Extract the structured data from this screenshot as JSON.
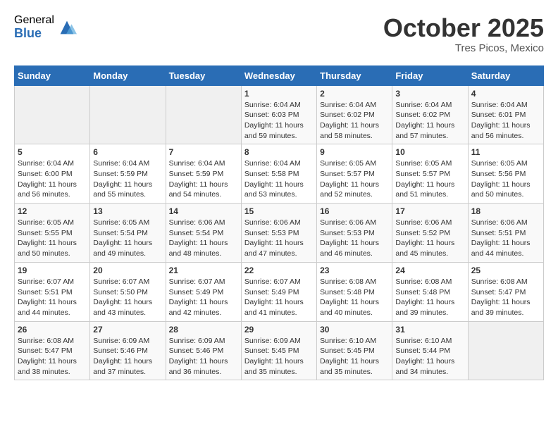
{
  "header": {
    "logo_general": "General",
    "logo_blue": "Blue",
    "month": "October 2025",
    "location": "Tres Picos, Mexico"
  },
  "days_of_week": [
    "Sunday",
    "Monday",
    "Tuesday",
    "Wednesday",
    "Thursday",
    "Friday",
    "Saturday"
  ],
  "weeks": [
    [
      {
        "day": "",
        "empty": true
      },
      {
        "day": "",
        "empty": true
      },
      {
        "day": "",
        "empty": true
      },
      {
        "day": "1",
        "sunrise": "6:04 AM",
        "sunset": "6:03 PM",
        "daylight": "11 hours and 59 minutes."
      },
      {
        "day": "2",
        "sunrise": "6:04 AM",
        "sunset": "6:02 PM",
        "daylight": "11 hours and 58 minutes."
      },
      {
        "day": "3",
        "sunrise": "6:04 AM",
        "sunset": "6:02 PM",
        "daylight": "11 hours and 57 minutes."
      },
      {
        "day": "4",
        "sunrise": "6:04 AM",
        "sunset": "6:01 PM",
        "daylight": "11 hours and 56 minutes."
      }
    ],
    [
      {
        "day": "5",
        "sunrise": "6:04 AM",
        "sunset": "6:00 PM",
        "daylight": "11 hours and 56 minutes."
      },
      {
        "day": "6",
        "sunrise": "6:04 AM",
        "sunset": "5:59 PM",
        "daylight": "11 hours and 55 minutes."
      },
      {
        "day": "7",
        "sunrise": "6:04 AM",
        "sunset": "5:59 PM",
        "daylight": "11 hours and 54 minutes."
      },
      {
        "day": "8",
        "sunrise": "6:04 AM",
        "sunset": "5:58 PM",
        "daylight": "11 hours and 53 minutes."
      },
      {
        "day": "9",
        "sunrise": "6:05 AM",
        "sunset": "5:57 PM",
        "daylight": "11 hours and 52 minutes."
      },
      {
        "day": "10",
        "sunrise": "6:05 AM",
        "sunset": "5:57 PM",
        "daylight": "11 hours and 51 minutes."
      },
      {
        "day": "11",
        "sunrise": "6:05 AM",
        "sunset": "5:56 PM",
        "daylight": "11 hours and 50 minutes."
      }
    ],
    [
      {
        "day": "12",
        "sunrise": "6:05 AM",
        "sunset": "5:55 PM",
        "daylight": "11 hours and 50 minutes."
      },
      {
        "day": "13",
        "sunrise": "6:05 AM",
        "sunset": "5:54 PM",
        "daylight": "11 hours and 49 minutes."
      },
      {
        "day": "14",
        "sunrise": "6:06 AM",
        "sunset": "5:54 PM",
        "daylight": "11 hours and 48 minutes."
      },
      {
        "day": "15",
        "sunrise": "6:06 AM",
        "sunset": "5:53 PM",
        "daylight": "11 hours and 47 minutes."
      },
      {
        "day": "16",
        "sunrise": "6:06 AM",
        "sunset": "5:53 PM",
        "daylight": "11 hours and 46 minutes."
      },
      {
        "day": "17",
        "sunrise": "6:06 AM",
        "sunset": "5:52 PM",
        "daylight": "11 hours and 45 minutes."
      },
      {
        "day": "18",
        "sunrise": "6:06 AM",
        "sunset": "5:51 PM",
        "daylight": "11 hours and 44 minutes."
      }
    ],
    [
      {
        "day": "19",
        "sunrise": "6:07 AM",
        "sunset": "5:51 PM",
        "daylight": "11 hours and 44 minutes."
      },
      {
        "day": "20",
        "sunrise": "6:07 AM",
        "sunset": "5:50 PM",
        "daylight": "11 hours and 43 minutes."
      },
      {
        "day": "21",
        "sunrise": "6:07 AM",
        "sunset": "5:49 PM",
        "daylight": "11 hours and 42 minutes."
      },
      {
        "day": "22",
        "sunrise": "6:07 AM",
        "sunset": "5:49 PM",
        "daylight": "11 hours and 41 minutes."
      },
      {
        "day": "23",
        "sunrise": "6:08 AM",
        "sunset": "5:48 PM",
        "daylight": "11 hours and 40 minutes."
      },
      {
        "day": "24",
        "sunrise": "6:08 AM",
        "sunset": "5:48 PM",
        "daylight": "11 hours and 39 minutes."
      },
      {
        "day": "25",
        "sunrise": "6:08 AM",
        "sunset": "5:47 PM",
        "daylight": "11 hours and 39 minutes."
      }
    ],
    [
      {
        "day": "26",
        "sunrise": "6:08 AM",
        "sunset": "5:47 PM",
        "daylight": "11 hours and 38 minutes."
      },
      {
        "day": "27",
        "sunrise": "6:09 AM",
        "sunset": "5:46 PM",
        "daylight": "11 hours and 37 minutes."
      },
      {
        "day": "28",
        "sunrise": "6:09 AM",
        "sunset": "5:46 PM",
        "daylight": "11 hours and 36 minutes."
      },
      {
        "day": "29",
        "sunrise": "6:09 AM",
        "sunset": "5:45 PM",
        "daylight": "11 hours and 35 minutes."
      },
      {
        "day": "30",
        "sunrise": "6:10 AM",
        "sunset": "5:45 PM",
        "daylight": "11 hours and 35 minutes."
      },
      {
        "day": "31",
        "sunrise": "6:10 AM",
        "sunset": "5:44 PM",
        "daylight": "11 hours and 34 minutes."
      },
      {
        "day": "",
        "empty": true
      }
    ]
  ],
  "labels": {
    "sunrise": "Sunrise:",
    "sunset": "Sunset:",
    "daylight": "Daylight:"
  }
}
